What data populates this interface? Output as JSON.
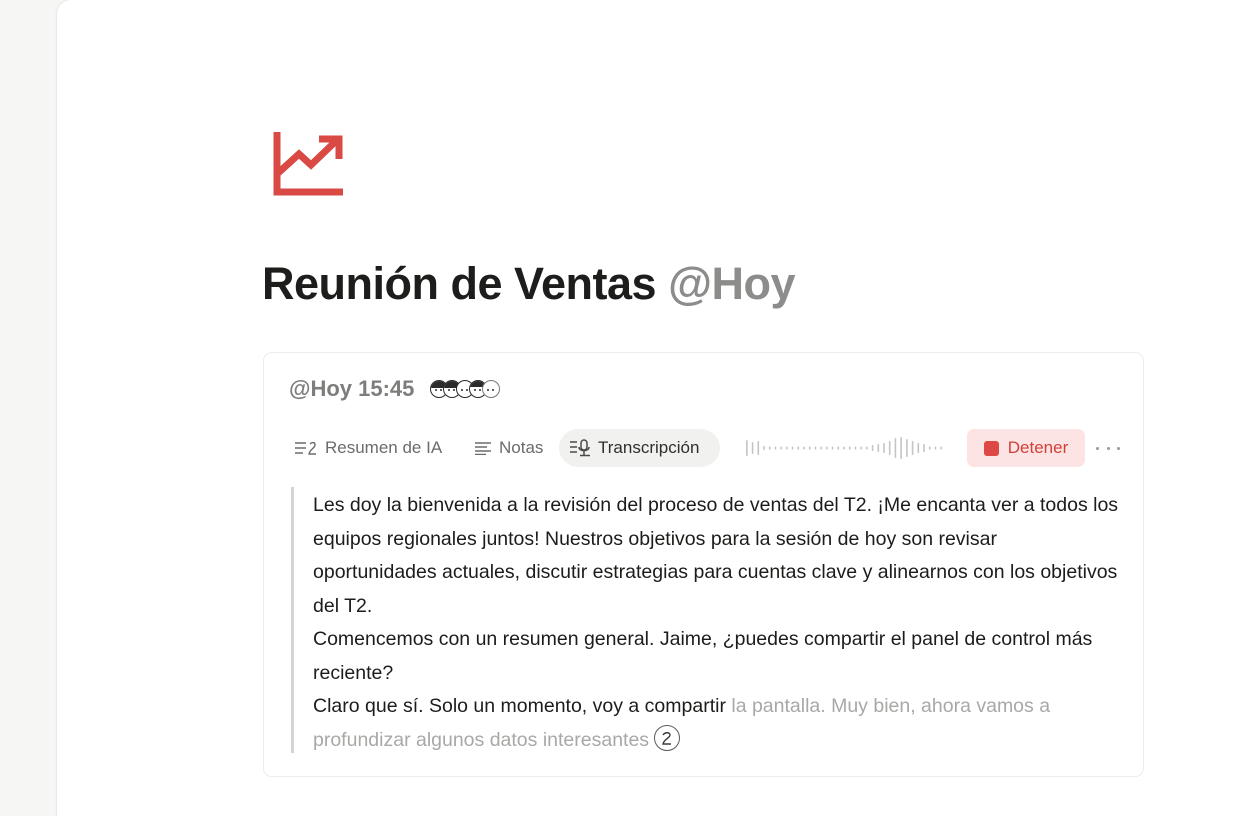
{
  "page": {
    "icon": "trending-up-icon",
    "title": "Reunión de Ventas",
    "title_mention": "@Hoy"
  },
  "meeting": {
    "datetime": "@Hoy 15:45",
    "participants_count": 5,
    "tabs": [
      {
        "label": "Resumen de IA",
        "icon": "ai-summary-icon",
        "active": false
      },
      {
        "label": "Notas",
        "icon": "notes-icon",
        "active": false
      },
      {
        "label": "Transcripción",
        "icon": "transcription-icon",
        "active": true
      }
    ],
    "stop_label": "Detener",
    "more_icon": "more-horizontal-icon",
    "transcript": {
      "paragraphs": [
        "Les doy la bienvenida a la revisión del proceso de ventas del T2. ¡Me encanta ver a todos los equipos regionales juntos! Nuestros objetivos para la sesión de hoy son revisar oportunidades actuales, discutir estrategias para cuentas clave y alinearnos con los objetivos del T2.",
        "Comencemos con un resumen general. Jaime, ¿puedes compartir el panel de control más reciente?"
      ],
      "last_confirmed": "Claro que sí. Solo un momento, voy a compartir",
      "last_pending": " la pantalla. Muy bien, ahora vamos a profundizar algunos datos interesantes"
    }
  },
  "colors": {
    "accent_red": "#d94a44",
    "stop_bg": "#fbe4e3",
    "muted_text": "#8c8c8a"
  }
}
